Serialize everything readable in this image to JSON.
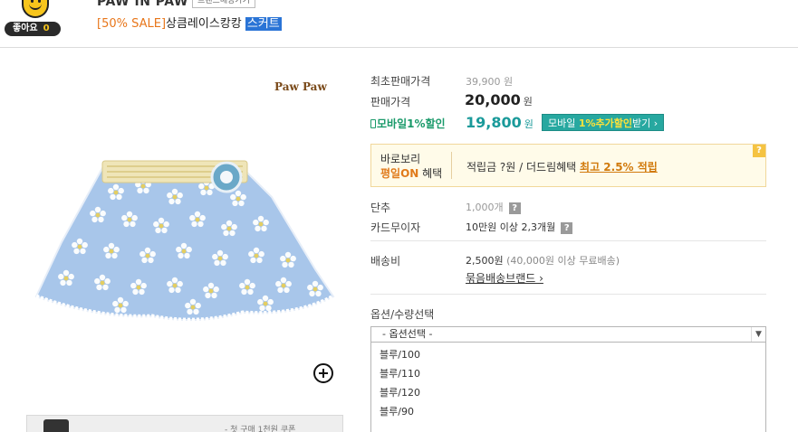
{
  "header": {
    "like_label": "좋아요",
    "like_count": "0",
    "brand_name": "PAW IN PAW",
    "brand_button": "브랜드매장가기",
    "sale_tag": "[50% SALE]",
    "product_title": "상큼레이스캉캉",
    "product_title_highlight": "스커트"
  },
  "image": {
    "brand_logo": "Paw Paw",
    "zoom_icon": "zoom-in-icon",
    "banner_text": "- 첫 구매 1천원 쿠폰"
  },
  "pricing": {
    "original_label": "최초판매가격",
    "original_price": "39,900 원",
    "sale_label": "판매가격",
    "sale_price": "20,000",
    "currency": "원",
    "mobile_label": "모바일1%할인",
    "mobile_price": "19,800",
    "coupon_prefix": "모바일 ",
    "coupon_highlight": "1%추가할인",
    "coupon_suffix": "받기 ›"
  },
  "benefit": {
    "line1": "바로보리",
    "line2_on": "평일ON",
    "line2_rest": " 혜택",
    "text": "적립금 ?원 / 더드림혜택 ",
    "link": "최고 2.5% 적립",
    "help": "?"
  },
  "details": {
    "dan_label": "단추",
    "dan_value": "1,000개",
    "card_label": "카드무이자",
    "card_value": "10만원 이상 2,3개월",
    "shipping_label": "배송비",
    "shipping_value": "2,500원",
    "shipping_note": "(40,000원 이상 무료배송)",
    "bundle_link": "묶음배송브랜드 ›",
    "help": "?"
  },
  "options": {
    "label": "옵션/수량선택",
    "select_placeholder": "- 옵션선택 -",
    "items": [
      "블루/100",
      "블루/110",
      "블루/120",
      "블루/90"
    ]
  },
  "colors": {
    "sale_orange": "#e8761a",
    "mobile_teal": "#1a9a9a",
    "coupon_bg": "#27a8a0",
    "benefit_bg": "#fffbe9"
  }
}
